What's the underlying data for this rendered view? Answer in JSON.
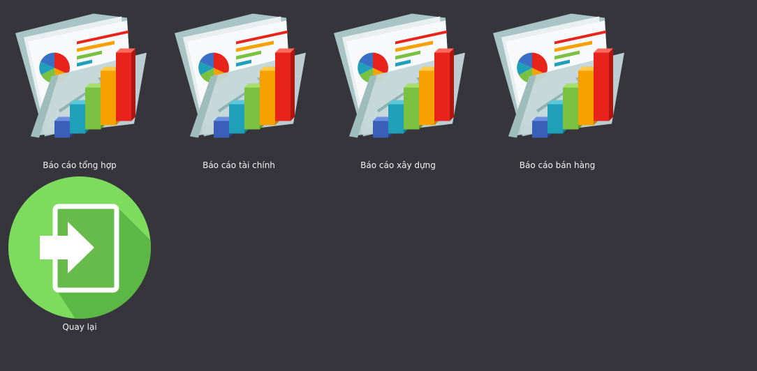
{
  "tiles": [
    {
      "label": "Báo cáo tổng hợp",
      "icon": "report-folder-icon"
    },
    {
      "label": "Báo cáo tài chính",
      "icon": "report-folder-icon"
    },
    {
      "label": "Báo cáo xây dựng",
      "icon": "report-folder-icon"
    },
    {
      "label": "Báo cáo bán hàng",
      "icon": "report-folder-icon"
    },
    {
      "label": "Quay lại",
      "icon": "exit-door-icon"
    }
  ],
  "colors": {
    "background": "#35353b",
    "label_text": "#f2f2f2",
    "back_circle": "#7ddc5e",
    "back_shadow": "#5cb845"
  }
}
